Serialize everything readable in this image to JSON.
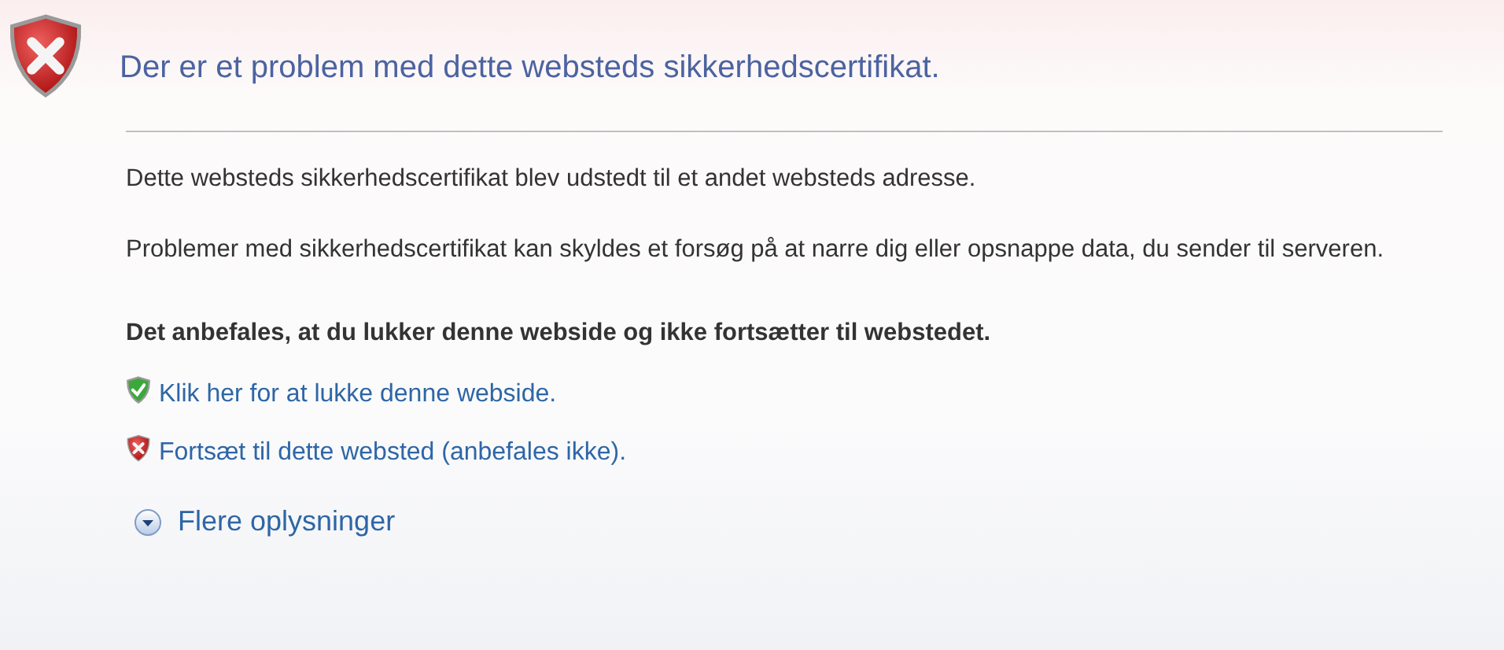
{
  "title": "Der er et problem med dette websteds sikkerhedscertifikat.",
  "paragraphs": [
    "Dette websteds sikkerhedscertifikat blev udstedt til et andet websteds adresse.",
    "Problemer med sikkerhedscertifikat kan skyldes et forsøg på at narre dig eller opsnappe data, du sender til serveren."
  ],
  "recommendation": "Det anbefales, at du lukker denne webside og ikke fortsætter til webstedet.",
  "links": [
    {
      "kind": "safe",
      "label": "Klik her for at lukke denne webside."
    },
    {
      "kind": "unsafe",
      "label": "Fortsæt til dette websted (anbefales ikke)."
    }
  ],
  "more_info": {
    "label": "Flere oplysninger",
    "expanded": false
  }
}
